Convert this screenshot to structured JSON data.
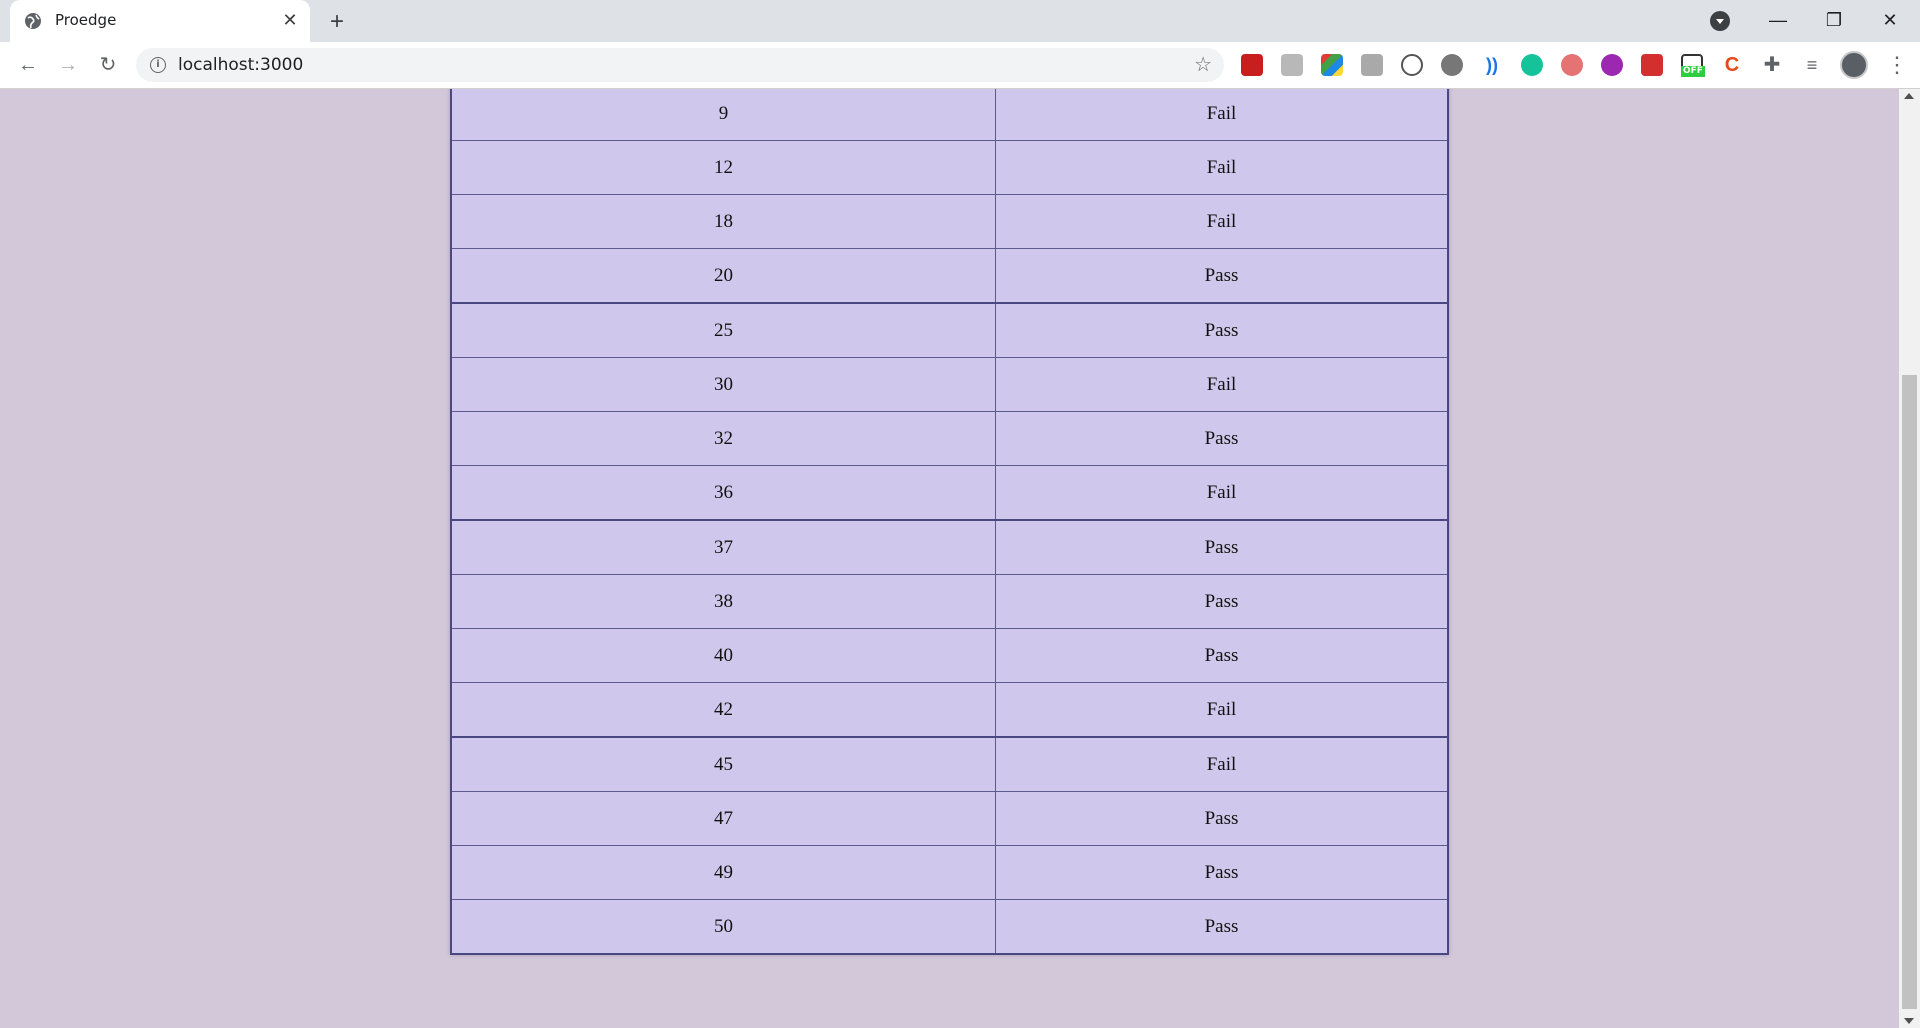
{
  "browser": {
    "tab_title": "Proedge",
    "tab_close": "✕",
    "new_tab": "+",
    "url": "localhost:3000",
    "window_controls": {
      "minimize": "—",
      "restore": "❐",
      "close": "✕"
    },
    "extension_icons": [
      "adobe-acrobat-icon",
      "extension-grey-icon",
      "extension-colored-grid-icon",
      "reader-icon",
      "code-viewer-icon",
      "circle-extension-icon",
      "wave-extension-icon",
      "grammarly-icon",
      "cloud-extension-icon",
      "purple-extension-icon",
      "red-extension-icon",
      "off-badge-extension-icon",
      "c-extension-icon",
      "puzzle-icon",
      "reading-list-icon"
    ],
    "off_badge": "OFF"
  },
  "table": {
    "rows": [
      {
        "value": "",
        "result": ""
      },
      {
        "value": "9",
        "result": "Fail"
      },
      {
        "value": "12",
        "result": "Fail"
      },
      {
        "value": "18",
        "result": "Fail"
      },
      {
        "value": "20",
        "result": "Pass"
      },
      {
        "value": "25",
        "result": "Pass"
      },
      {
        "value": "30",
        "result": "Fail"
      },
      {
        "value": "32",
        "result": "Pass"
      },
      {
        "value": "36",
        "result": "Fail"
      },
      {
        "value": "37",
        "result": "Pass"
      },
      {
        "value": "38",
        "result": "Pass"
      },
      {
        "value": "40",
        "result": "Pass"
      },
      {
        "value": "42",
        "result": "Fail"
      },
      {
        "value": "45",
        "result": "Fail"
      },
      {
        "value": "47",
        "result": "Pass"
      },
      {
        "value": "49",
        "result": "Pass"
      },
      {
        "value": "50",
        "result": "Pass"
      }
    ]
  },
  "colors": {
    "page_background": "#d3c8da",
    "table_background": "#cfc8ec",
    "table_border": "#4a4880"
  }
}
